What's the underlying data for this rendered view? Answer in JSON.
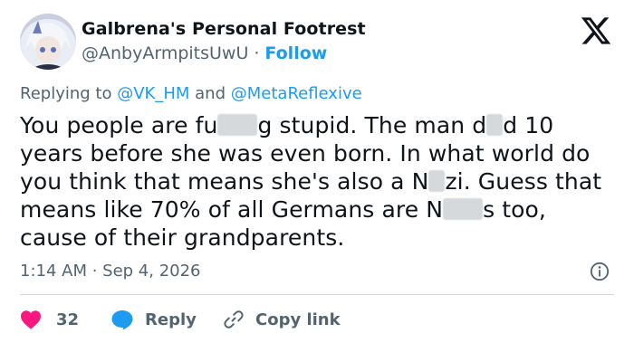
{
  "author": {
    "display_name": "Galbrena's Personal Footrest",
    "handle": "@AnbyArmpitsUwU",
    "separator": "·",
    "follow_label": "Follow"
  },
  "platform_icon": "x-logo-icon",
  "reply_context": {
    "prefix": "Replying to",
    "mention_1": "@VK_HM",
    "conjunction": "and",
    "mention_2": "@MetaReflexive"
  },
  "tweet": {
    "line1_a": "You people are fu",
    "line1_b": "g stupid. The man d",
    "line1_c": "d 10",
    "line2": "years before she was even born. In what world do",
    "line3_a": "you think that means she's also a N",
    "line3_b": "zi. Guess that",
    "line4_a": "means like 70% of all Germans are N",
    "line4_b": "s too,",
    "line5": "cause of their grandparents."
  },
  "timestamp": "1:14 AM · Sep 4, 2026",
  "actions": {
    "like_count": "32",
    "reply_label": "Reply",
    "copy_label": "Copy link"
  },
  "colors": {
    "accent": "#1d9bf0",
    "like": "#f91880",
    "secondary_text": "#536471",
    "primary_text": "#0f1419"
  }
}
